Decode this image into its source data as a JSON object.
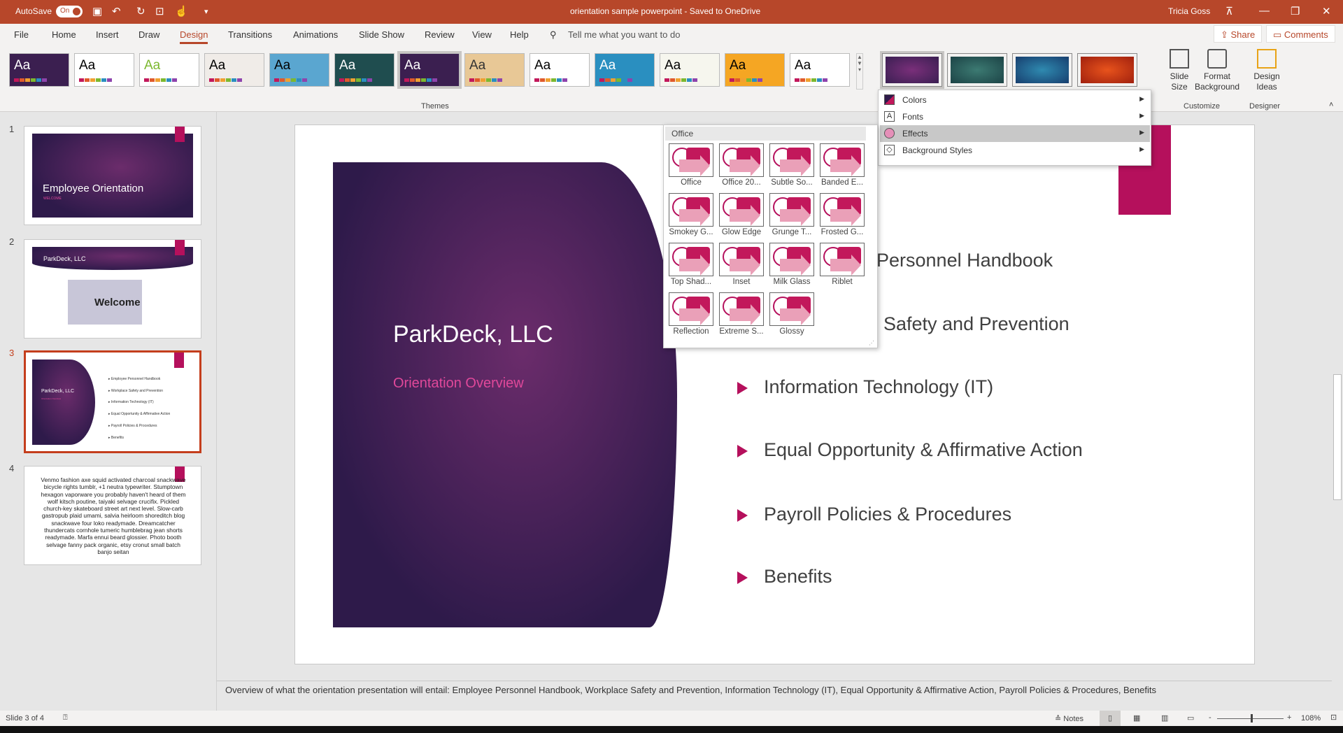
{
  "titlebar": {
    "autosave": "AutoSave",
    "toggle": "On",
    "title": "orientation sample powerpoint  -  Saved to OneDrive",
    "user": "Tricia Goss",
    "color": "#b7472a"
  },
  "tabs": [
    "File",
    "Home",
    "Insert",
    "Draw",
    "Design",
    "Transitions",
    "Animations",
    "Slide Show",
    "Review",
    "View",
    "Help"
  ],
  "active_tab": "Design",
  "tell_me": "Tell me what you want to do",
  "share": "Share",
  "comments": "Comments",
  "ribbon": {
    "themes_label": "Themes",
    "theme_sample": "Aa",
    "customize_label": "Customize",
    "designer_label": "Designer",
    "slide_size": "Slide Size",
    "format_background": "Format Background",
    "design_ideas": "Design Ideas"
  },
  "variants_menu": {
    "items": [
      "Colors",
      "Fonts",
      "Effects",
      "Background Styles"
    ],
    "highlighted": "Effects"
  },
  "effects_gallery": {
    "header": "Office",
    "items": [
      "Office",
      "Office 20...",
      "Subtle So...",
      "Banded E...",
      "Smokey G...",
      "Glow Edge",
      "Grunge T...",
      "Frosted G...",
      "Top Shad...",
      "Inset",
      "Milk Glass",
      "Riblet",
      "Reflection",
      "Extreme S...",
      "Glossy"
    ]
  },
  "slides": [
    {
      "num": "1",
      "title": "Employee Orientation",
      "subtitle": "WELCOME"
    },
    {
      "num": "2",
      "title": "ParkDeck, LLC",
      "image_text": "Welcome"
    },
    {
      "num": "3",
      "title": "ParkDeck, LLC",
      "subtitle": "Orientation Overview"
    },
    {
      "num": "4",
      "body": "Venmo fashion axe squid activated charcoal snackwave bicycle rights tumblr, +1 neutra typewriter. Stumptown hexagon vaporware you probably haven't heard of them wolf kitsch poutine, taiyaki selvage crucifix. Pickled church-key skateboard street art next level. Slow-carb gastropub plaid umami, salvia heirloom shoreditch blog snackwave four loko readymade. Dreamcatcher thundercats cornhole tumeric humblebrag jean shorts readymade. Marfa ennui beard glossier. Photo booth selvage fanny pack organic, etsy cronut small batch banjo seitan"
    }
  ],
  "current_slide": {
    "title": "ParkDeck, LLC",
    "subtitle": "Orientation Overview",
    "bullets": [
      "Employee Personnel Handbook",
      "Workplace Safety and Prevention",
      "Information Technology (IT)",
      "Equal Opportunity & Affirmative Action",
      "Payroll Policies & Procedures",
      "Benefits"
    ],
    "visible_bullets": [
      "Personnel Handbook",
      "Safety and Prevention",
      "Information Technology (IT)",
      "Equal Opportunity & Affirmative Action",
      "Payroll Policies & Procedures",
      "Benefits"
    ]
  },
  "notes": "Overview of what the orientation presentation will entail: Employee Personnel Handbook, Workplace Safety and Prevention, Information Technology (IT), Equal Opportunity & Affirmative Action, Payroll Policies & Procedures, Benefits",
  "status": {
    "slide": "Slide 3 of 4",
    "notes": "Notes",
    "zoom": "108%"
  },
  "colors": {
    "accent": "#b5105c",
    "subtitle": "#e0489a"
  }
}
